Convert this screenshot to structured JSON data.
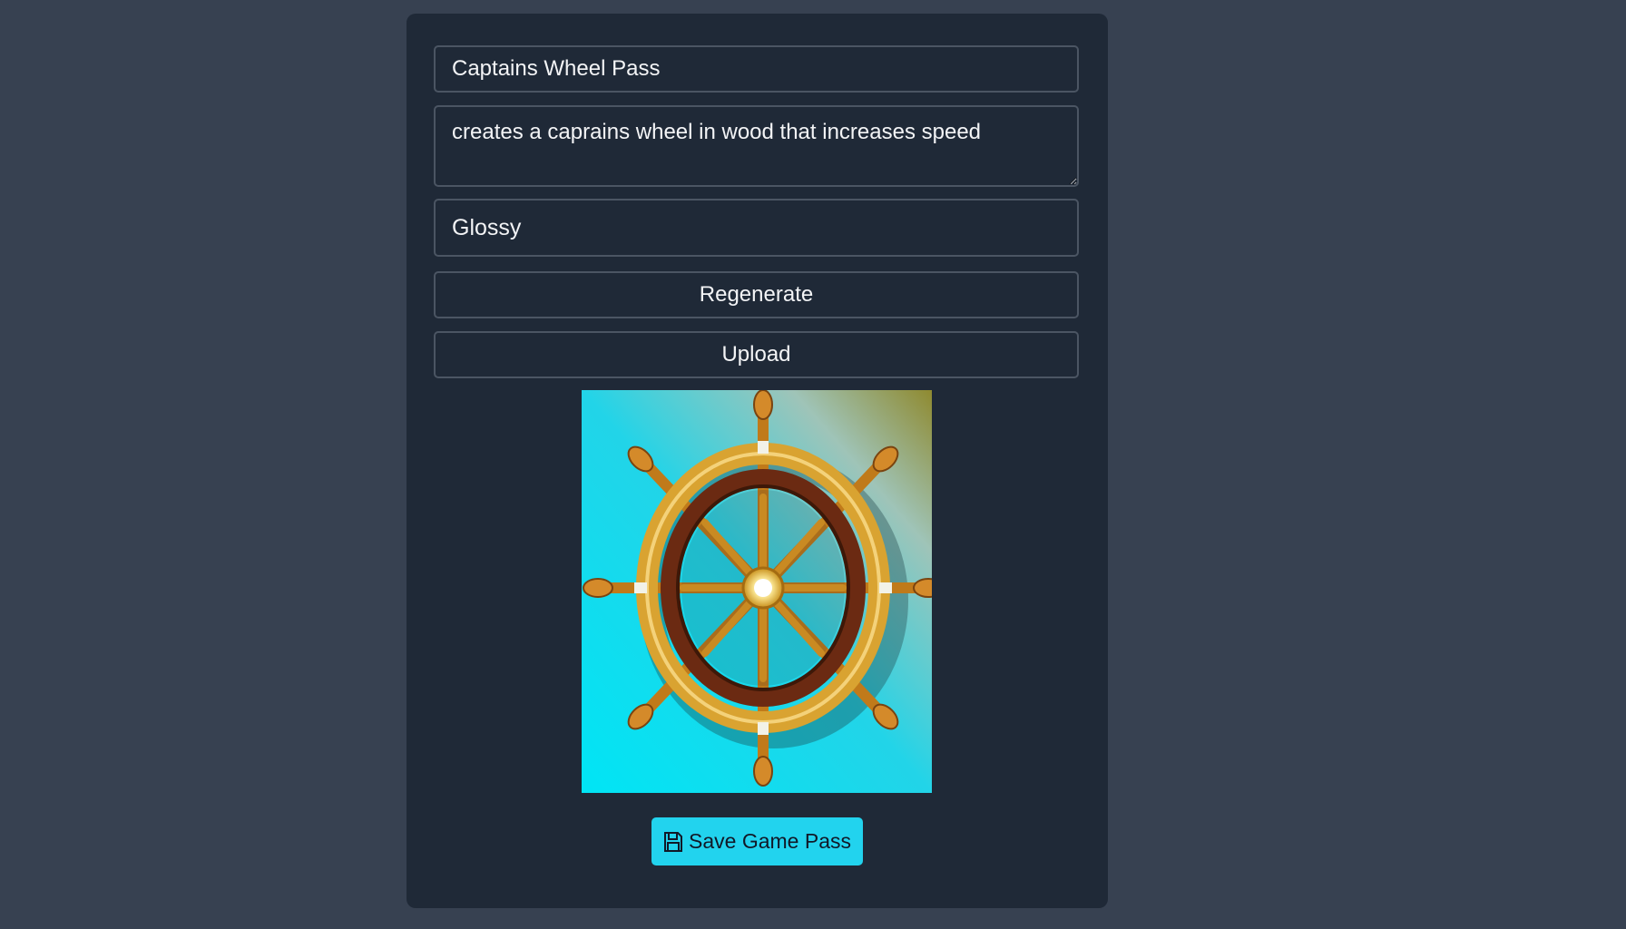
{
  "form": {
    "name_value": "Captains Wheel Pass",
    "description_value": "creates a caprains wheel in wood that increases speed",
    "style_value": "Glossy",
    "regenerate_label": "Regenerate",
    "upload_label": "Upload",
    "save_label": "Save Game Pass",
    "save_icon": "floppy-disk-icon"
  },
  "colors": {
    "page_bg": "#374151",
    "card_bg": "#1f2937",
    "border": "#4b5563",
    "accent": "#22d3ee",
    "text": "#f3f4f6"
  }
}
